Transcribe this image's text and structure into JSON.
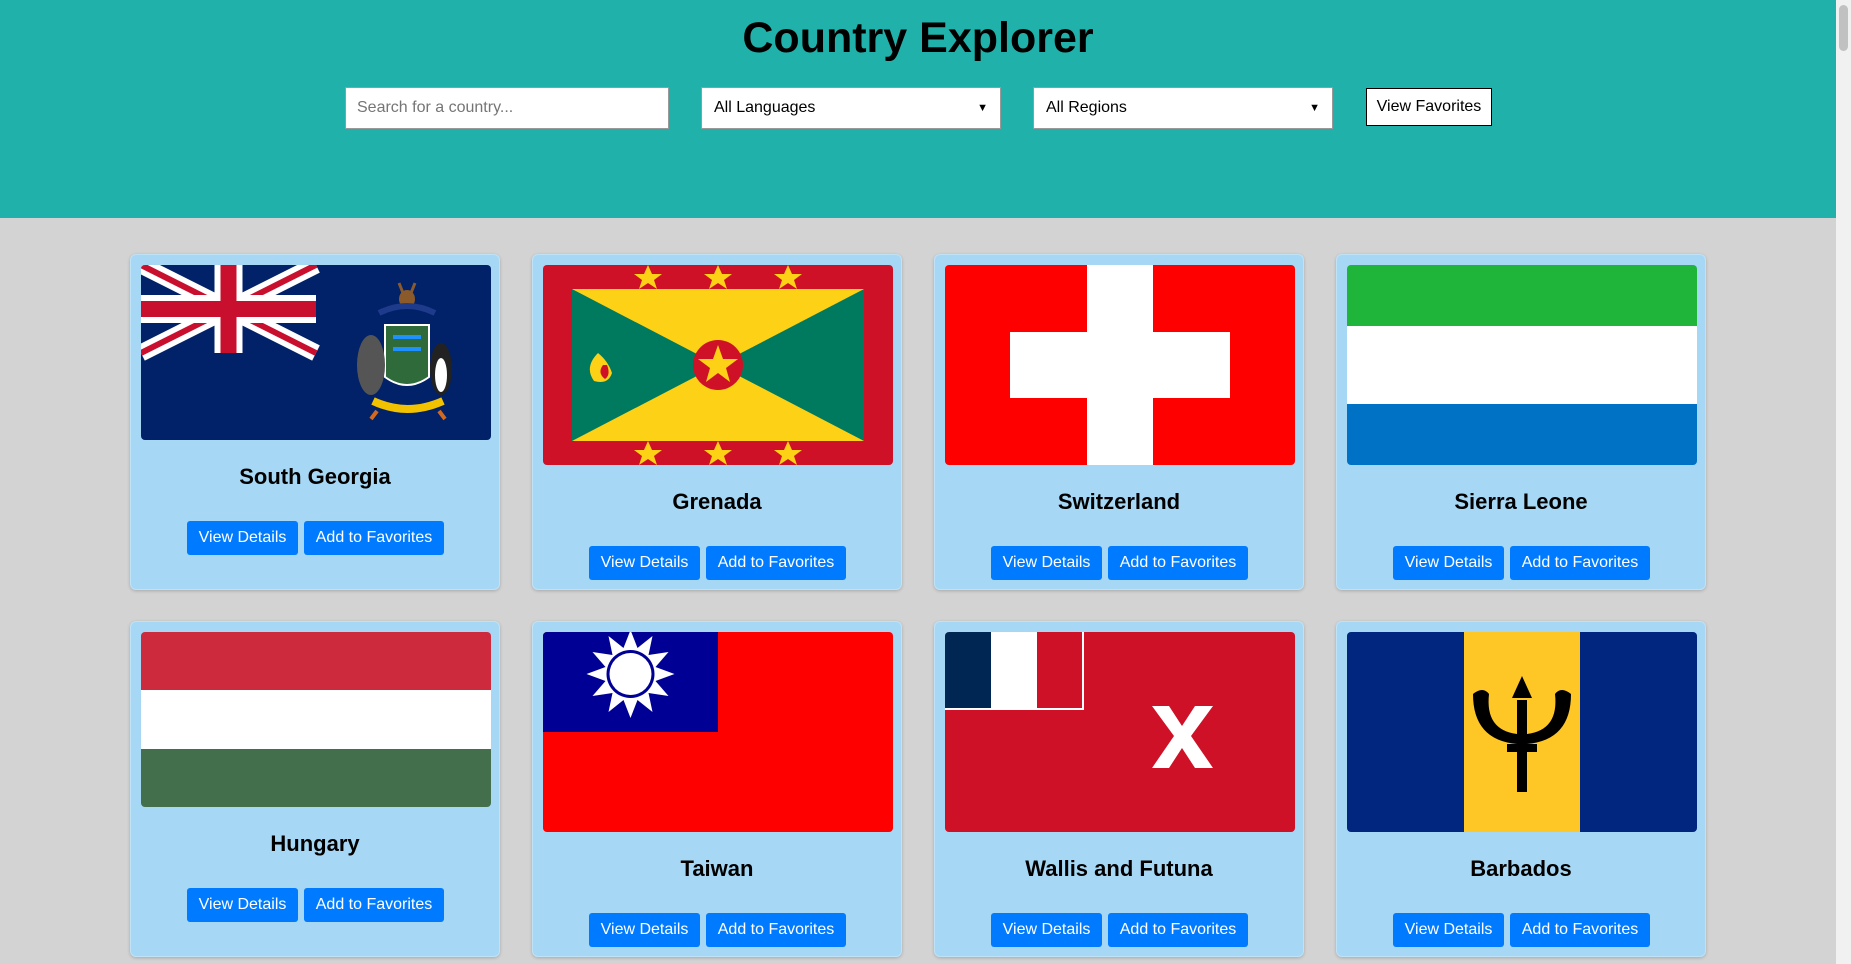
{
  "header": {
    "title": "Country Explorer",
    "search_placeholder": "Search for a country...",
    "language_filter": "All Languages",
    "region_filter": "All Regions",
    "favorites_button": "View Favorites"
  },
  "card_buttons": {
    "details": "View Details",
    "favorite": "Add to Favorites"
  },
  "countries": [
    {
      "name": "South Georgia",
      "flag_icon": "south-georgia-flag-icon"
    },
    {
      "name": "Grenada",
      "flag_icon": "grenada-flag-icon"
    },
    {
      "name": "Switzerland",
      "flag_icon": "switzerland-flag-icon"
    },
    {
      "name": "Sierra Leone",
      "flag_icon": "sierra-leone-flag-icon"
    },
    {
      "name": "Hungary",
      "flag_icon": "hungary-flag-icon"
    },
    {
      "name": "Taiwan",
      "flag_icon": "taiwan-flag-icon"
    },
    {
      "name": "Wallis and Futuna",
      "flag_icon": "wallis-and-futuna-flag-icon"
    },
    {
      "name": "Barbados",
      "flag_icon": "barbados-flag-icon"
    }
  ],
  "colors": {
    "header_bg": "#20b2aa",
    "page_bg": "#d3d3d3",
    "card_bg": "#a6d8f5",
    "button_bg": "#007bff"
  }
}
